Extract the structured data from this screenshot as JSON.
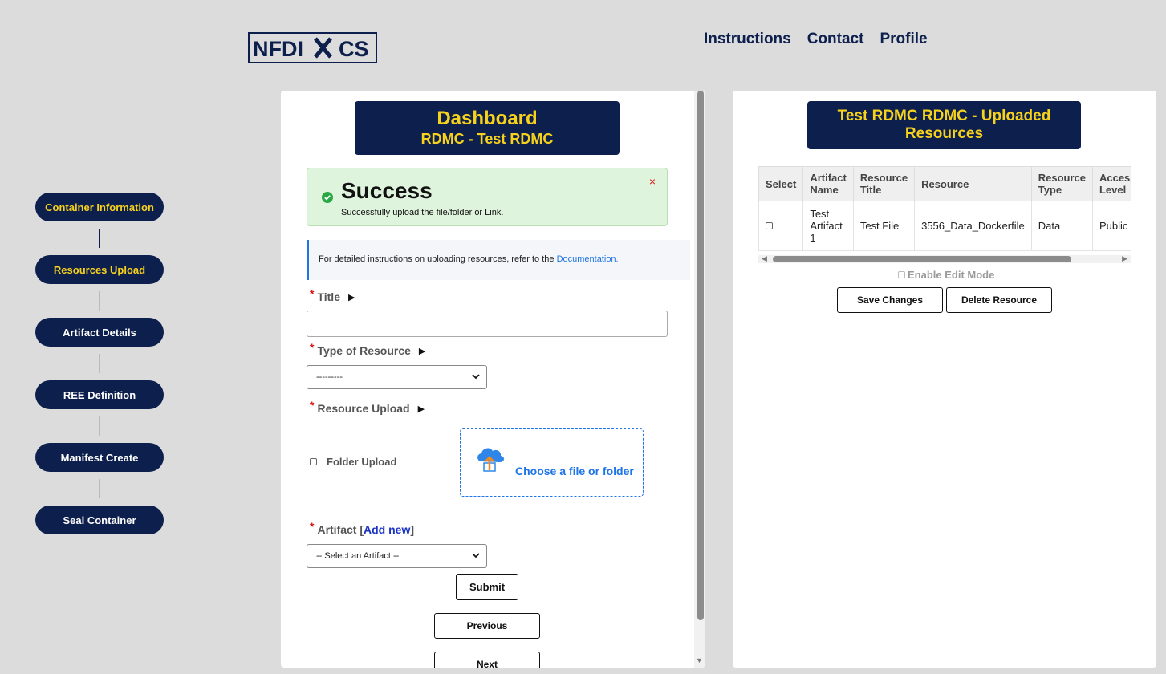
{
  "header": {
    "logo_text": "NFDI×CS",
    "nav": [
      "Instructions",
      "Contact",
      "Profile"
    ]
  },
  "stepper": {
    "steps": [
      {
        "label": "Container Information",
        "state": "done"
      },
      {
        "label": "Resources Upload",
        "state": "active"
      },
      {
        "label": "Artifact Details",
        "state": "pending"
      },
      {
        "label": "REE Definition",
        "state": "pending"
      },
      {
        "label": "Manifest Create",
        "state": "pending"
      },
      {
        "label": "Seal Container",
        "state": "pending"
      }
    ]
  },
  "dashboard": {
    "title": "Dashboard",
    "subtitle": "RDMC - Test RDMC",
    "alert": {
      "title": "Success",
      "message": "Successfully upload the file/folder or Link.",
      "close": "×"
    },
    "info": {
      "text": "For detailed instructions on uploading resources, refer to the ",
      "link": "Documentation."
    },
    "form": {
      "required_mark": "*",
      "title_label": "Title",
      "type_label": "Type of Resource",
      "type_value": "---------",
      "upload_label": "Resource Upload",
      "folder_upload_label": "Folder Upload",
      "dropzone_text": "Choose a file or folder",
      "artifact_label": "Artifact [",
      "artifact_add_new": "Add new",
      "artifact_close": "]",
      "artifact_value": "-- Select an Artifact --",
      "submit": "Submit",
      "previous": "Previous",
      "next": "Next"
    }
  },
  "resources": {
    "title": "Test RDMC RDMC - Uploaded Resources",
    "columns": [
      "Select",
      "Artifact Name",
      "Resource Title",
      "Resource",
      "Resource Type",
      "Access Level"
    ],
    "rows": [
      {
        "artifact_name": "Test Artifact 1",
        "resource_title": "Test File",
        "resource": "3556_Data_Dockerfile",
        "resource_type": "Data",
        "access_level": "Public"
      }
    ],
    "edit_mode_label": "Enable Edit Mode",
    "save_button": "Save Changes",
    "delete_button": "Delete Resource"
  },
  "colors": {
    "navy": "#0d1f4d",
    "accent_yellow": "#f7d21c",
    "success_bg": "#dff4dc",
    "link_blue": "#1f74e6",
    "required_red": "#dd1111"
  }
}
